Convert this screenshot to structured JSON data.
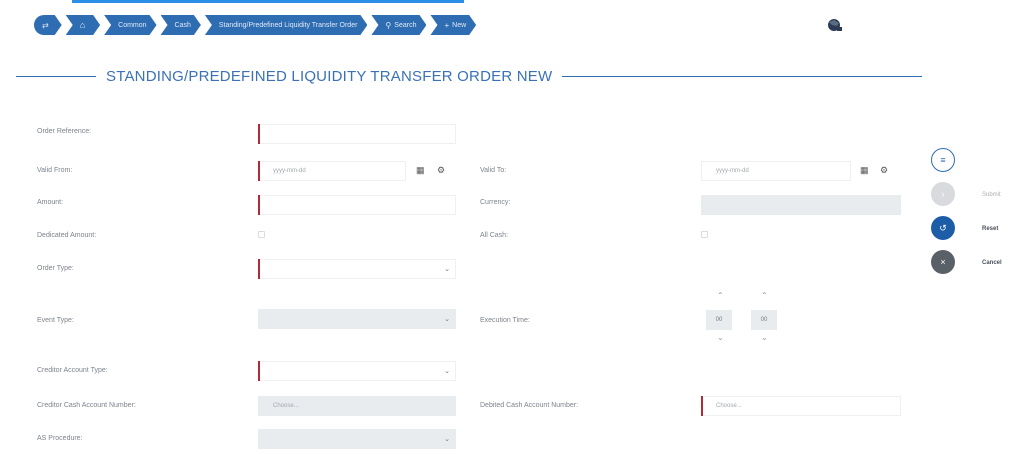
{
  "breadcrumb": {
    "items": [
      {
        "label": "",
        "icon": "back-icon",
        "glyph": "⇄"
      },
      {
        "label": "",
        "icon": "home-icon",
        "glyph": "⌂"
      },
      {
        "label": "Common",
        "icon": null,
        "glyph": ""
      },
      {
        "label": "Cash",
        "icon": null,
        "glyph": ""
      },
      {
        "label": "Standing/Predefined Liquidity Transfer Order",
        "icon": null,
        "glyph": ""
      },
      {
        "label": "Search",
        "icon": "search-icon",
        "glyph": "⚲"
      },
      {
        "label": "New",
        "icon": "plus-icon",
        "glyph": "+"
      }
    ]
  },
  "page": {
    "title": "STANDING/PREDEFINED LIQUIDITY TRANSFER ORDER NEW"
  },
  "form": {
    "order_reference": {
      "label": "Order Reference:",
      "value": ""
    },
    "valid_from": {
      "label": "Valid From:",
      "placeholder": "yyyy-mm-dd"
    },
    "valid_to": {
      "label": "Valid To:",
      "placeholder": "yyyy-mm-dd"
    },
    "amount": {
      "label": "Amount:",
      "value": ""
    },
    "currency": {
      "label": "Currency:",
      "value": ""
    },
    "dedicated_amount": {
      "label": "Dedicated Amount:"
    },
    "all_cash": {
      "label": "All Cash:"
    },
    "order_type": {
      "label": "Order Type:",
      "value": ""
    },
    "event_type": {
      "label": "Event Type:",
      "value": ""
    },
    "execution_time": {
      "label": "Execution Time:",
      "hours": "00",
      "minutes": "00"
    },
    "creditor_account_type": {
      "label": "Creditor Account Type:",
      "value": ""
    },
    "creditor_cash_account_number": {
      "label": "Creditor Cash Account Number:",
      "placeholder": "Choose..."
    },
    "debited_cash_account_number": {
      "label": "Debited Cash Account Number:",
      "placeholder": "Choose..."
    },
    "ai_procedure": {
      "label": "AS Procedure:",
      "value": ""
    }
  },
  "actions": {
    "submit_label": "Submit",
    "reset_label": "Reset",
    "cancel_label": "Cancel"
  },
  "colors": {
    "accent": "#2f6db3",
    "required_marker": "#b22a36",
    "title": "#3a71b8"
  }
}
